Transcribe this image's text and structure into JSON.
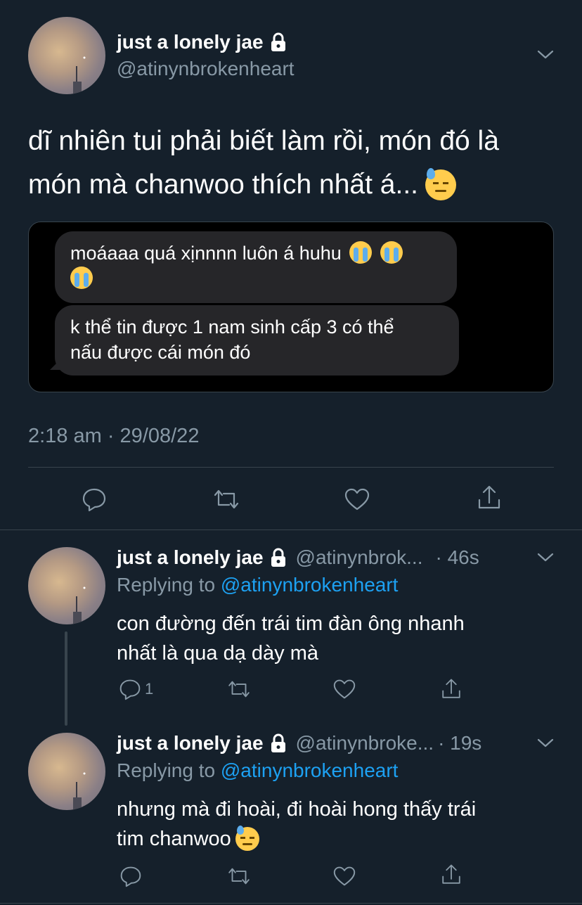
{
  "main_tweet": {
    "display_name": "just a lonely jae",
    "handle": "@atinynbrokenheart",
    "text_line1": "dĩ nhiên tui phải biết làm rồi, món đó là",
    "text_line2": "món mà chanwoo thích nhất á...",
    "image": {
      "message1_line1": "moáaaa quá xịnnnn luôn á huhu",
      "message2_line1": "k thể tin được 1 nam sinh cấp 3 có thể",
      "message2_line2": "nấu được cái món đó"
    },
    "timestamp": "2:18 am · 29/08/22"
  },
  "replies": [
    {
      "display_name": "just a lonely jae",
      "handle": "@atinynbrok...",
      "time": "· 46s",
      "replying_prefix": "Replying to",
      "replying_handle": "@atinynbrokenheart",
      "text_line1": "con đường đến trái tim đàn ông nhanh",
      "text_line2": "nhất là qua dạ dày mà",
      "reply_count": "1"
    },
    {
      "display_name": "just a lonely jae",
      "handle": "@atinynbroke...",
      "time": "· 19s",
      "replying_prefix": "Replying to",
      "replying_handle": "@atinynbrokenheart",
      "text_line1": "nhưng mà đi hoài, đi hoài hong thấy trái",
      "text_line2": "tim chanwoo"
    }
  ],
  "icons": [
    "lock-icon",
    "chevron-down-icon",
    "reply-icon",
    "retweet-icon",
    "like-icon",
    "share-icon",
    "loudly-crying-face-emoji",
    "downcast-face-with-sweat-emoji"
  ],
  "colors": {
    "background": "#15202b",
    "text": "#ffffff",
    "muted": "#8899a6",
    "link": "#1da1f2",
    "divider": "#38444d"
  }
}
